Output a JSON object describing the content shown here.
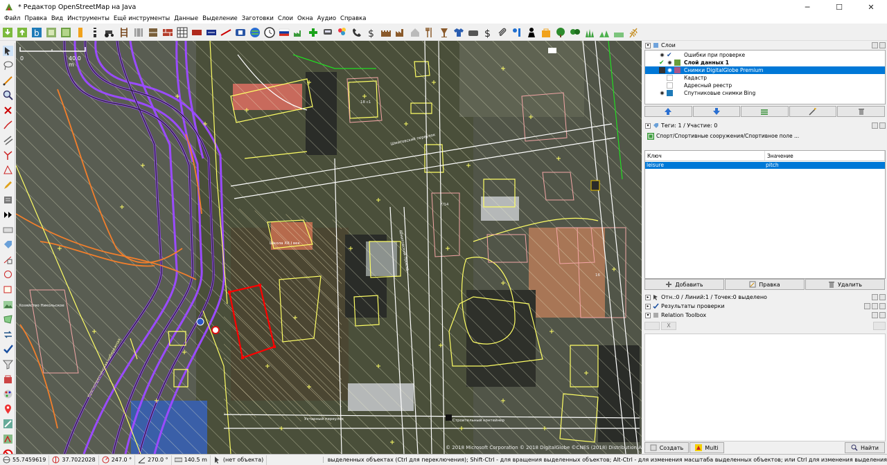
{
  "window": {
    "title": "* Редактор OpenStreetMap на Java",
    "minimize": "─",
    "maximize": "☐",
    "close": "✕"
  },
  "menu": [
    "Файл",
    "Правка",
    "Вид",
    "Инструменты",
    "Ещё инструменты",
    "Данные",
    "Выделение",
    "Заготовки",
    "Слои",
    "Окна",
    "Аудио",
    "Справка"
  ],
  "map": {
    "scale_zero": "0",
    "scale_label": "40.0 m",
    "labels": {
      "school": "Школа XX I век",
      "street_side_top": "Шмитовский переулок",
      "street_lane": "Шмитовский проезд",
      "street_bottom": "Ухтарный переулок",
      "building_container": "Строительный контейнер",
      "street_left": "Краснопресненская набережная",
      "area_left": "Хозяйство Никольское",
      "num_7_14": "7/14",
      "num_16": "16",
      "num_18": "18 с1"
    },
    "attribution": "© 2018 Microsoft Corporation © 2018 DigitalGlobe ©CNES (2018) Distribution Airbus DS"
  },
  "layers_panel": {
    "title": "Слои",
    "layers": [
      {
        "name": "Ошибки при проверке",
        "bold": false,
        "selected": false
      },
      {
        "name": "Слой данных 1",
        "bold": true,
        "selected": false
      },
      {
        "name": "Снимки DigitalGlobe Premium",
        "bold": false,
        "selected": true
      },
      {
        "name": "Кадастр",
        "bold": false,
        "selected": false
      },
      {
        "name": "Адресный реестр",
        "bold": false,
        "selected": false
      },
      {
        "name": "Спутниковые снимки Bing",
        "bold": false,
        "selected": false
      }
    ]
  },
  "tags_panel": {
    "title": "Теги: 1 / Участие: 0",
    "preset": "Спорт/Спортивные сооружения/Спортивное поле ...",
    "col_key": "Ключ",
    "col_value": "Значение",
    "rows": [
      {
        "key": "leisure",
        "value": "pitch"
      }
    ],
    "add": "Добавить",
    "edit": "Правка",
    "delete": "Удалить"
  },
  "selection_panel": {
    "title": "Отн.:0 / Линий:1 / Точек:0 выделено"
  },
  "validation_panel": {
    "title": "Результаты проверки"
  },
  "relation_toolbox": {
    "title": "Relation Toolbox",
    "close_label": "X"
  },
  "bottom_buttons": {
    "create": "Создать",
    "multi": "Multi",
    "search": "Найти"
  },
  "status": {
    "lat": "55.7459619",
    "lon": "37.7022028",
    "heading": "247.0 °",
    "angle": "270.0 °",
    "distance": "140.5 m",
    "object": "(нет объекта)",
    "help": "выделенных объектах (Ctrl для переключения); Shift-Ctrl - для вращения выделенных объектов; Alt-Ctrl - для изменения масштаба выделенных объектов; или Ctrl для изменения выделения"
  },
  "colors": {
    "selection_blue": "#0078d7",
    "selected_way": "#ff0000",
    "building_outline": "#ffff66",
    "road_purple": "#9a4bff"
  }
}
